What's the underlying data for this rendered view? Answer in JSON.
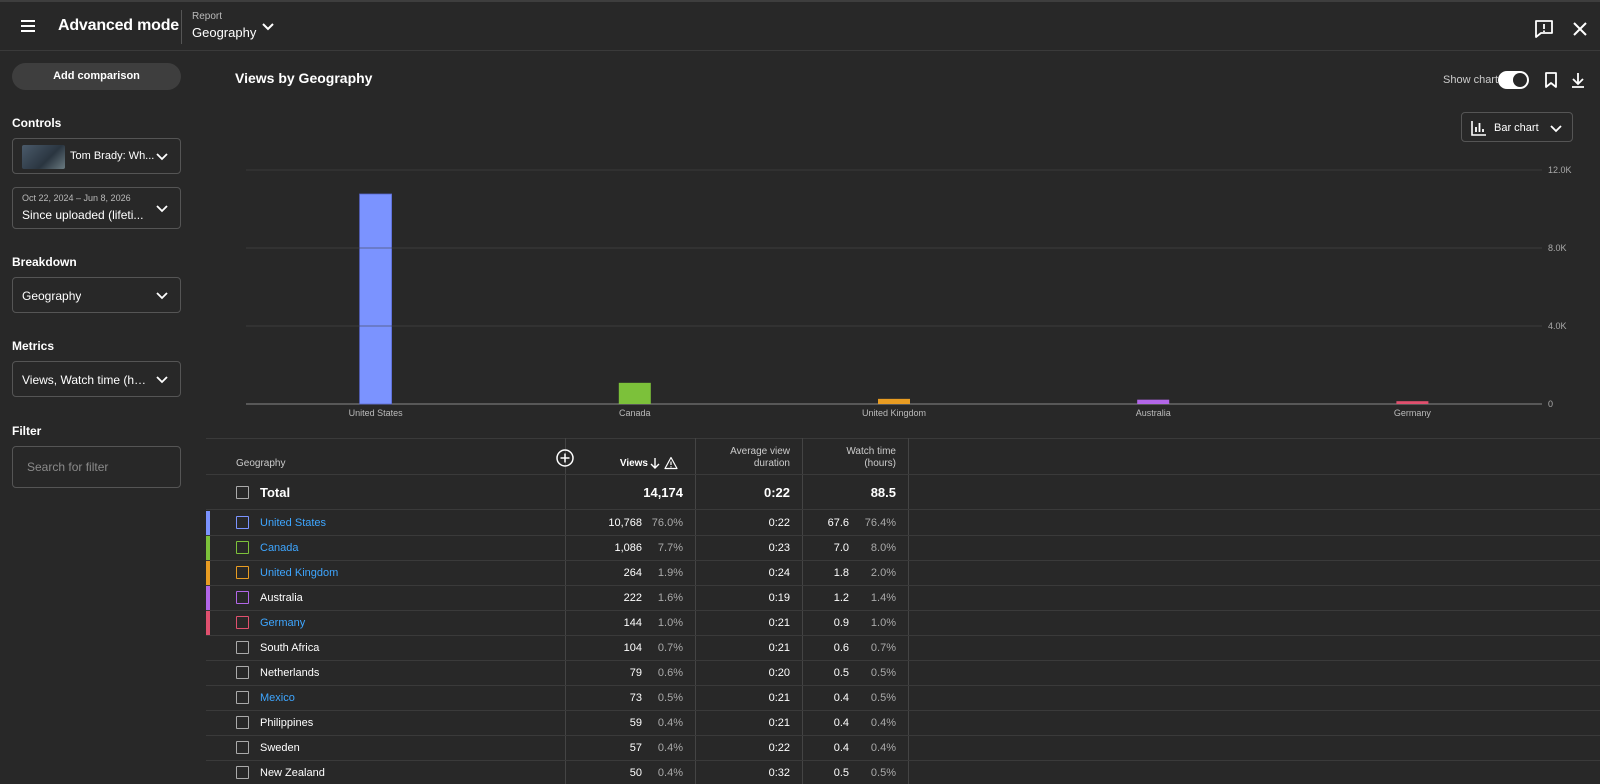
{
  "header": {
    "title": "Advanced mode",
    "report_caption": "Report",
    "report_value": "Geography"
  },
  "sidebar": {
    "add_comparison": "Add comparison",
    "controls_label": "Controls",
    "content_value": "Tom Brady: Wh...",
    "date_range_caption": "Oct 22, 2024 – Jun 8, 2026",
    "date_range_value": "Since uploaded (lifeti...",
    "breakdown_label": "Breakdown",
    "breakdown_value": "Geography",
    "metrics_label": "Metrics",
    "metrics_value": "Views, Watch time (ho...",
    "filter_label": "Filter",
    "filter_placeholder": "Search for filter"
  },
  "chart_header": {
    "title": "Views by Geography",
    "show_chart_label": "Show chart",
    "show_chart_on": true,
    "chart_type": "Bar chart"
  },
  "chart_data": {
    "type": "bar",
    "categories": [
      "United States",
      "Canada",
      "United Kingdom",
      "Australia",
      "Germany"
    ],
    "values": [
      10768,
      1086,
      264,
      222,
      144
    ],
    "colors": [
      "#7b93ff",
      "#7cc13a",
      "#e89c22",
      "#b266e8",
      "#e0506e"
    ],
    "yticks": [
      "0",
      "4.0K",
      "8.0K",
      "12.0K"
    ],
    "ylim": [
      0,
      12000
    ],
    "grid": true
  },
  "table": {
    "columns": {
      "geography": "Geography",
      "views": "Views",
      "avg_duration_1": "Average view",
      "avg_duration_2": "duration",
      "watch_time_1": "Watch time",
      "watch_time_2": "(hours)"
    },
    "total": {
      "label": "Total",
      "views": "14,174",
      "avg": "0:22",
      "watch": "88.5"
    },
    "rows": [
      {
        "name": "United States",
        "link": true,
        "color": "#7b93ff",
        "views": "10,768",
        "views_pct": "76.0%",
        "avg": "0:22",
        "watch": "67.6",
        "watch_pct": "76.4%"
      },
      {
        "name": "Canada",
        "link": true,
        "color": "#7cc13a",
        "views": "1,086",
        "views_pct": "7.7%",
        "avg": "0:23",
        "watch": "7.0",
        "watch_pct": "8.0%"
      },
      {
        "name": "United Kingdom",
        "link": true,
        "color": "#e89c22",
        "views": "264",
        "views_pct": "1.9%",
        "avg": "0:24",
        "watch": "1.8",
        "watch_pct": "2.0%"
      },
      {
        "name": "Australia",
        "link": false,
        "color": "#b266e8",
        "views": "222",
        "views_pct": "1.6%",
        "avg": "0:19",
        "watch": "1.2",
        "watch_pct": "1.4%"
      },
      {
        "name": "Germany",
        "link": true,
        "color": "#e0506e",
        "views": "144",
        "views_pct": "1.0%",
        "avg": "0:21",
        "watch": "0.9",
        "watch_pct": "1.0%"
      },
      {
        "name": "South Africa",
        "link": false,
        "color": "",
        "views": "104",
        "views_pct": "0.7%",
        "avg": "0:21",
        "watch": "0.6",
        "watch_pct": "0.7%"
      },
      {
        "name": "Netherlands",
        "link": false,
        "color": "",
        "views": "79",
        "views_pct": "0.6%",
        "avg": "0:20",
        "watch": "0.5",
        "watch_pct": "0.5%"
      },
      {
        "name": "Mexico",
        "link": true,
        "color": "",
        "views": "73",
        "views_pct": "0.5%",
        "avg": "0:21",
        "watch": "0.4",
        "watch_pct": "0.5%"
      },
      {
        "name": "Philippines",
        "link": false,
        "color": "",
        "views": "59",
        "views_pct": "0.4%",
        "avg": "0:21",
        "watch": "0.4",
        "watch_pct": "0.4%"
      },
      {
        "name": "Sweden",
        "link": false,
        "color": "",
        "views": "57",
        "views_pct": "0.4%",
        "avg": "0:22",
        "watch": "0.4",
        "watch_pct": "0.4%"
      },
      {
        "name": "New Zealand",
        "link": false,
        "color": "",
        "views": "50",
        "views_pct": "0.4%",
        "avg": "0:32",
        "watch": "0.5",
        "watch_pct": "0.5%"
      }
    ]
  }
}
